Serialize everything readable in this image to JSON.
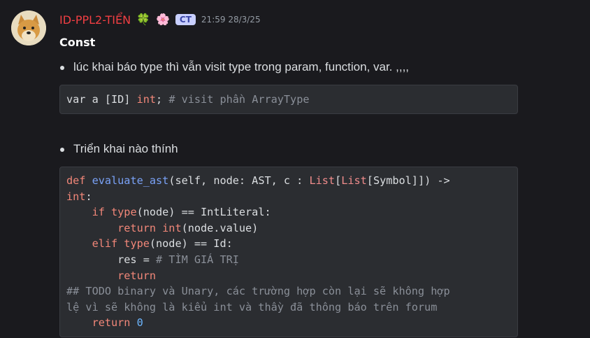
{
  "message": {
    "username": "ID-PPL2-TIỂN",
    "emoji1": "🍀",
    "emoji2": "🌸",
    "tag": "CT",
    "timestamp": "21:59 28/3/25",
    "title": "Const",
    "bullet1": "lúc khai báo type thì vẫn visit type trong param, function, var. ,,,,",
    "bullet2": "Triển khai nào thính"
  },
  "code1": {
    "t1": "var a [ID] ",
    "t2": "int",
    "t3": "; ",
    "t4": "# visit phần ArrayType"
  },
  "code2": {
    "l1_def": "def",
    "l1_fn": " evaluate_ast",
    "l1_a": "(self, node: AST, c : ",
    "l1_list1": "List",
    "l1_b": "[",
    "l1_list2": "List",
    "l1_c": "[Symbol]]) ->",
    "l2_int": "int",
    "l2_rest": ":",
    "l3_if": "    if",
    "l3_type": " type",
    "l3_rest": "(node) == IntLiteral:",
    "l4_ret": "        return",
    "l4_int": " int",
    "l4_rest": "(node.value)",
    "l5_elif": "    elif",
    "l5_type": " type",
    "l5_rest": "(node) == Id:",
    "l6_a": "        res = ",
    "l6_cm": "# TÌM GIÁ TRỊ",
    "l7_ret": "        return",
    "l8_cm": "## TODO binary và Unary, các trường hợp còn lại sẽ không hợp",
    "l9_cm": "lệ vì sẽ không là kiểu int và thầy đã thông báo trên forum",
    "l10_ret": "    return",
    "l10_num": " 0"
  }
}
